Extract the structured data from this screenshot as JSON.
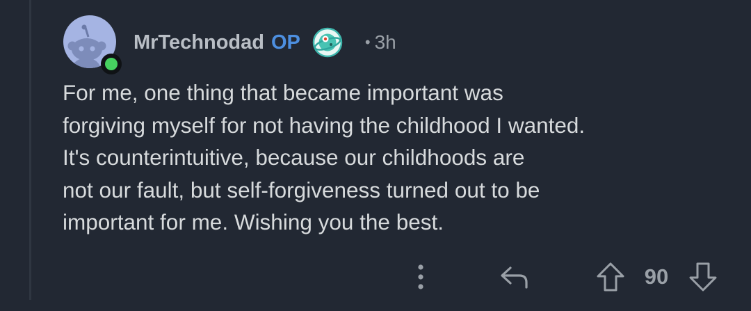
{
  "comment": {
    "author": "MrTechnodad",
    "op_badge": "OP",
    "separator": "•",
    "age": "3h",
    "online": true,
    "flair_icon": "planet-snoo-icon",
    "body_lines": [
      "For me, one thing that became important was",
      "forgiving myself for not having the childhood I wanted.",
      "It's counterintuitive, because our childhoods are",
      "not our fault, but self-forgiveness turned out to be",
      "important for me. Wishing you the best."
    ]
  },
  "actions": {
    "more_icon": "more-vertical-icon",
    "reply_icon": "reply-arrow-icon",
    "upvote_icon": "upvote-arrow-icon",
    "downvote_icon": "downvote-arrow-icon",
    "score": "90"
  },
  "colors": {
    "background": "#222833",
    "username": "#b9bec5",
    "op": "#4d8fe0",
    "text": "#d7dadc",
    "muted": "#9aa0a7",
    "online": "#46d160"
  }
}
